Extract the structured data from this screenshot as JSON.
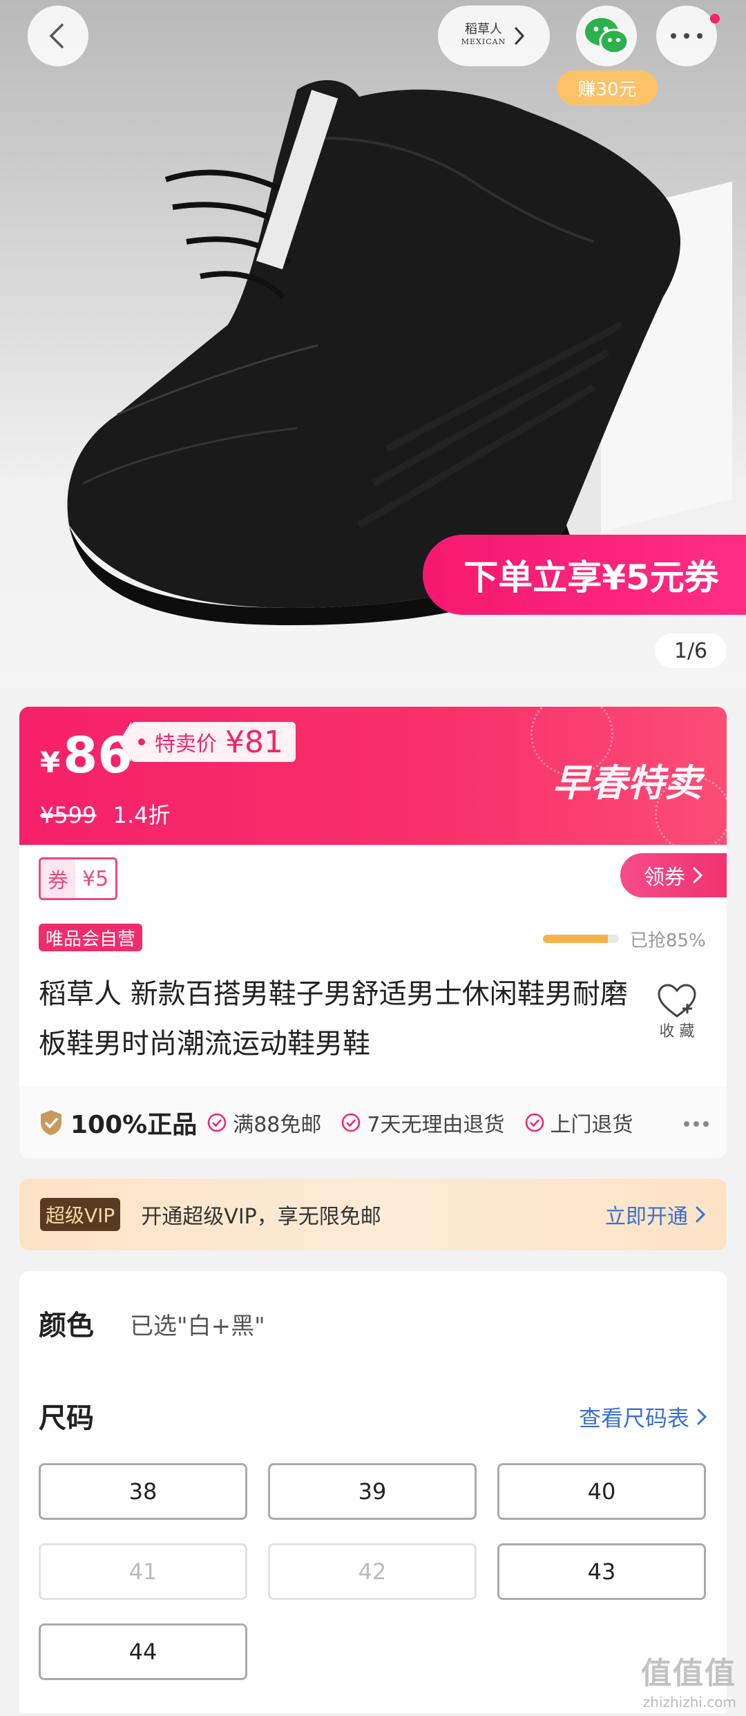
{
  "header": {
    "brand_logo_cn": "稻草人",
    "brand_logo_en": "MEXICAN",
    "earn_label": "赚30元",
    "back_icon": "chevron-left-icon",
    "share_icon": "wechat-icon",
    "more_icon": "more-dots-icon"
  },
  "hero": {
    "promo_banner": "下单立享¥5元券",
    "pager": "1/6"
  },
  "price": {
    "currency": "¥",
    "current": "86",
    "special_label": "特卖价",
    "special_price": "¥81",
    "original": "¥599",
    "discount": "1.4折",
    "season_title": "早春特卖"
  },
  "coupon": {
    "label": "券",
    "amount": "¥5",
    "get_button": "领券"
  },
  "product": {
    "self_operated_badge": "唯品会自营",
    "grabbed_text": "已抢85%",
    "grabbed_fraction": 0.85,
    "title": "稻草人 新款百搭男鞋子男舒适男士休闲鞋男耐磨板鞋男时尚潮流运动鞋男鞋",
    "favorite_label": "收 藏"
  },
  "guarantee": {
    "main": "100%正品",
    "items": [
      "满88免邮",
      "7天无理由退货",
      "上门退货"
    ]
  },
  "vip": {
    "badge": "超级VIP",
    "text": "开通超级VIP，享无限免邮",
    "action": "立即开通"
  },
  "spec": {
    "color_label": "颜色",
    "color_value": "已选\"白+黑\"",
    "size_label": "尺码",
    "size_chart": "查看尺码表",
    "sizes": [
      {
        "label": "38",
        "disabled": false
      },
      {
        "label": "39",
        "disabled": false
      },
      {
        "label": "40",
        "disabled": false
      },
      {
        "label": "41",
        "disabled": true
      },
      {
        "label": "42",
        "disabled": true
      },
      {
        "label": "43",
        "disabled": false
      },
      {
        "label": "44",
        "disabled": false
      }
    ]
  },
  "watermark": {
    "mark": "值值值",
    "url": "zhizhizhi.com"
  },
  "colors": {
    "accent": "#f5216a",
    "link": "#3a70d0",
    "earn": "#fbc268",
    "progress": "#f4b44a"
  }
}
